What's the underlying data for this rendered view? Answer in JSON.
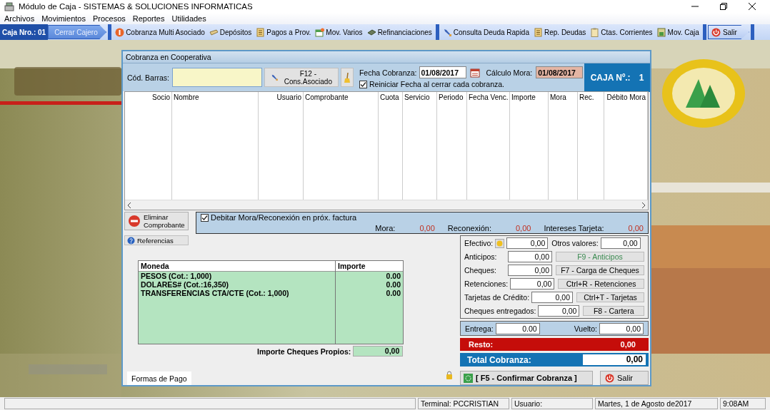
{
  "window": {
    "title": "Módulo de Caja - SISTEMAS & SOLUCIONES INFORMATICAS"
  },
  "menu": [
    "Archivos",
    "Movimientos",
    "Procesos",
    "Reportes",
    "Utilidades"
  ],
  "toolbar": {
    "caja_label": "Caja Nro.: 01",
    "cerrar_button": {
      "label": "Cerrar Cajero",
      "disabled": true
    },
    "groups": [
      [
        "Cobranza Multi Asociado",
        "Depósitos",
        "Pagos a Prov.",
        "Mov. Varios",
        "Refinanciaciones"
      ],
      [
        "Consulta Deuda Rapida",
        "Rep. Deudas",
        "Ctas. Corrientes",
        "Mov. Caja"
      ]
    ],
    "exit_button": "Salir"
  },
  "dialog": {
    "title": "Cobranza en Cooperativa",
    "barcode_label": "Cód. Barras:",
    "lookup_button": [
      "F12 -",
      "Cons.Asociado"
    ],
    "fecha_cobranza": {
      "label": "Fecha Cobranza:",
      "value": "01/08/2017"
    },
    "calculo_mora": {
      "label": "Cálculo Mora:",
      "value": "01/08/2017"
    },
    "reiniciar": {
      "label": "Reiniciar Fecha al cerrar cada cobranza.",
      "checked": true
    },
    "caja": {
      "label": "CAJA Nº.:",
      "value": "1"
    },
    "table": {
      "columns": [
        "Socio",
        "Nombre",
        "Usuario",
        "Comprobante",
        "Cuota",
        "Servicio",
        "Periodo",
        "Fecha Venc.",
        "Importe",
        "Mora",
        "Rec.",
        "Débito Mora"
      ]
    },
    "eliminar_button": [
      "Eliminar",
      "Comprobante"
    ],
    "referencias_button": "Referencias",
    "debitar": {
      "label": "Debitar Mora/Reconexión en próx. factura",
      "checked": true
    },
    "totals": [
      {
        "label": "Mora:",
        "value": "0,00"
      },
      {
        "label": "Reconexión:",
        "value": "0,00"
      },
      {
        "label": "Intereses Tarjeta:",
        "value": "0,00"
      }
    ],
    "formas": {
      "columns": [
        "Moneda",
        "Importe"
      ],
      "rows": [
        [
          "PESOS (Cot.: 1,000)",
          "0.00"
        ],
        [
          "DOLARES# (Cot.:16,350)",
          "0.00"
        ],
        [
          "TRANSFERENCIAS CTA/CTE (Cot.: 1,000)",
          "0.00"
        ]
      ]
    },
    "cheques_propios": {
      "label": "Importe Cheques Propios:",
      "value": "0,00"
    },
    "tabs": [
      {
        "label": "Formas de Pago",
        "selected": true
      }
    ],
    "payments": [
      {
        "kind": "pair",
        "label": "Efectivo:",
        "value": "0,00",
        "other_label": "Otros valores:",
        "other_value": "0,00"
      },
      {
        "kind": "button",
        "label": "Anticipos:",
        "value": "0,00",
        "button": "F9 - Anticipos",
        "disabled": true
      },
      {
        "kind": "button",
        "label": "Cheques:",
        "value": "0,00",
        "button": "F7 - Carga de Cheques",
        "disabled": false
      },
      {
        "kind": "button",
        "label": "Retenciones:",
        "value": "0,00",
        "button": "Ctrl+R - Retenciones",
        "disabled": false
      },
      {
        "kind": "button",
        "label": "Tarjetas de Crédito:",
        "value": "0,00",
        "button": "Ctrl+T - Tarjetas",
        "disabled": false
      },
      {
        "kind": "button",
        "label": "Cheques entregados:",
        "value": "0,00",
        "button": "F8 - Cartera",
        "disabled": false
      }
    ],
    "entrega": {
      "label": "Entrega:",
      "value": "0.00"
    },
    "vuelto": {
      "label": "Vuelto:",
      "value": "0,00"
    },
    "resto": {
      "label": "Resto:",
      "value": "0,00"
    },
    "total": {
      "label": "Total Cobranza:",
      "value": "0,00"
    },
    "confirm_button": "[ F5 - Confirmar Cobranza ]",
    "salir_button": "Salir"
  },
  "status_bar": {
    "terminal": "Terminal: PCCRISTIAN",
    "usuario": "Usuario:",
    "date": "Martes,  1 de Agosto de2017",
    "time": "9:08AM"
  }
}
